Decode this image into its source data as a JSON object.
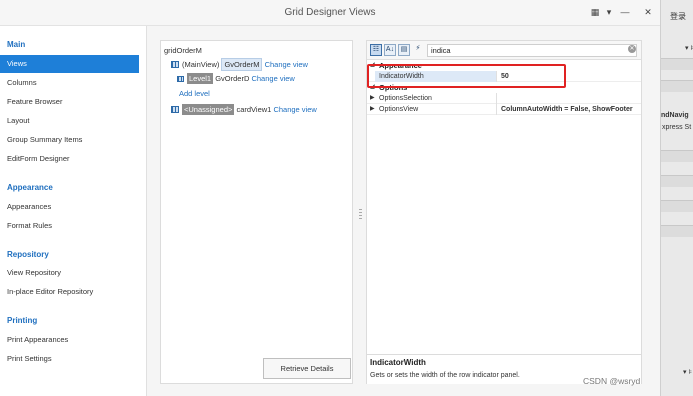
{
  "window": {
    "title": "Grid Designer Views",
    "buttons": {
      "layout": "▦",
      "dropdown": "▾",
      "minimize": "—",
      "maximize": "□",
      "close": "✕"
    }
  },
  "sidebar": {
    "sections": [
      {
        "header": "Main",
        "items": [
          "Views",
          "Columns",
          "Feature Browser",
          "Layout",
          "Group Summary Items",
          "EditForm Designer"
        ]
      },
      {
        "header": "Appearance",
        "items": [
          "Appearances",
          "Format Rules"
        ]
      },
      {
        "header": "Repository",
        "items": [
          "View Repository",
          "In-place Editor Repository"
        ]
      },
      {
        "header": "Printing",
        "items": [
          "Print Appearances",
          "Print Settings"
        ]
      }
    ],
    "active_item": "Views"
  },
  "tree": {
    "grid_name": "gridOrderM",
    "main_view_label": "(MainView)",
    "main_view_name": "GvOrderM",
    "change_view": "Change view",
    "level_label": "Level1",
    "level_view_name": "GvOrderD",
    "add_level": "Add level",
    "unassigned_label": "<Unassigned>",
    "unassigned_view_name": "cardView1",
    "retrieve_button": "Retrieve Details"
  },
  "properties": {
    "toolbar": {
      "categorized": "☷",
      "alphabetical": "A↓",
      "props": "▤",
      "events": "⚡"
    },
    "search_value": "indica",
    "search_clear": "✕",
    "categories": [
      {
        "name": "Appearance",
        "rows": [
          {
            "name": "IndicatorWidth",
            "value": "50"
          }
        ]
      },
      {
        "name": "Options",
        "rows": [
          {
            "name": "OptionsSelection",
            "value": ""
          },
          {
            "name": "OptionsView",
            "value": "ColumnAutoWidth = False, ShowFooter"
          }
        ]
      }
    ],
    "description_title": "IndicatorWidth",
    "description_text": "Gets or sets the width of the row indicator panel."
  },
  "right_strip": {
    "login": "登录",
    "nav_text": "ndNavig",
    "express_text": "xpress St",
    "pin_top": "▾ ⊧",
    "pin_bottom": "▾ ⊧"
  },
  "watermark": "CSDN @wsryd",
  "colors": {
    "accent": "#1e7fd8",
    "link": "#1f6fbf",
    "highlight": "#e02222"
  }
}
